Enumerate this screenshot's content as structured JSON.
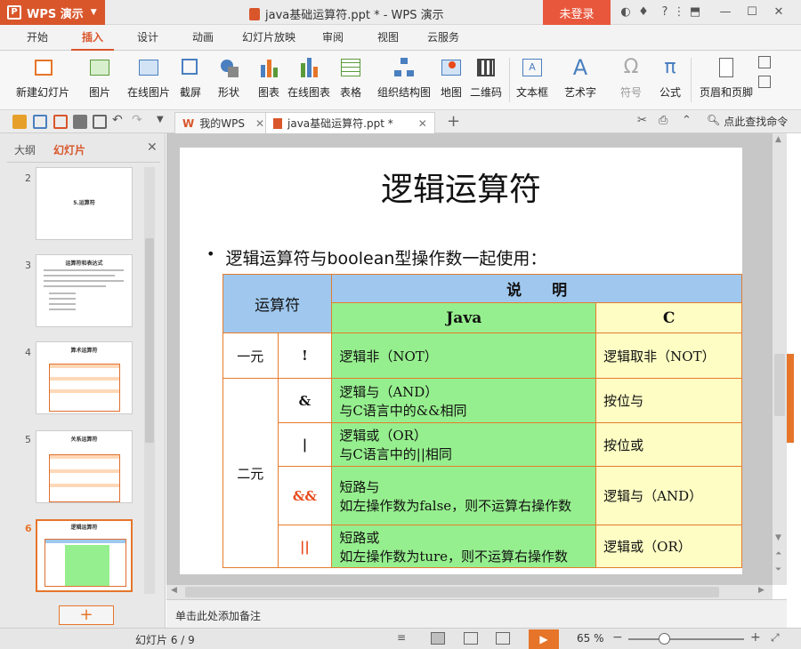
{
  "app": {
    "name": "WPS 演示",
    "window_title": "java基础运算符.ppt * - WPS 演示",
    "login": "未登录"
  },
  "ribbon_tabs": [
    "开始",
    "插入",
    "设计",
    "动画",
    "幻灯片放映",
    "审阅",
    "视图",
    "云服务"
  ],
  "active_tab_index": 1,
  "tools": [
    {
      "label": "新建幻灯片",
      "icon": "new-slide-icon"
    },
    {
      "label": "图片",
      "icon": "picture-icon"
    },
    {
      "label": "在线图片",
      "icon": "online-picture-icon"
    },
    {
      "label": "截屏",
      "icon": "screenshot-icon"
    },
    {
      "label": "形状",
      "icon": "shapes-icon"
    },
    {
      "label": "图表",
      "icon": "chart-icon"
    },
    {
      "label": "在线图表",
      "icon": "online-chart-icon"
    },
    {
      "label": "表格",
      "icon": "table-icon"
    },
    {
      "label": "组织结构图",
      "icon": "org-chart-icon"
    },
    {
      "label": "地图",
      "icon": "map-icon"
    },
    {
      "label": "二维码",
      "icon": "qrcode-icon"
    },
    {
      "label": "文本框",
      "icon": "textbox-icon"
    },
    {
      "label": "艺术字",
      "icon": "wordart-icon"
    },
    {
      "label": "符号",
      "icon": "symbol-icon"
    },
    {
      "label": "公式",
      "icon": "formula-icon"
    },
    {
      "label": "页眉和页脚",
      "icon": "header-footer-icon"
    }
  ],
  "doc_tabs": [
    {
      "label": "我的WPS"
    },
    {
      "label": "java基础运算符.ppt *"
    }
  ],
  "search_hint": "点此查找命令",
  "left_panel": {
    "tabs": [
      "大纲",
      "幻灯片"
    ],
    "slides": [
      {
        "num": "2",
        "title": "5.运算符"
      },
      {
        "num": "3",
        "title": "运算符和表达式"
      },
      {
        "num": "4",
        "title": "算术运算符"
      },
      {
        "num": "5",
        "title": "关系运算符"
      },
      {
        "num": "6",
        "title": "逻辑运算符"
      }
    ],
    "add_label": "+"
  },
  "slide": {
    "title": "逻辑运算符",
    "bullet": "逻辑运算符与boolean型操作数一起使用：",
    "table": {
      "header_op": "运算符",
      "header_desc": "说　　明",
      "header_java": "Java",
      "header_c": "C",
      "group_unary": "一元",
      "group_binary": "二元",
      "rows": [
        {
          "op": "!",
          "java1": "逻辑非（NOT）",
          "java2": "",
          "c": "逻辑取非（NOT）"
        },
        {
          "op": "&",
          "java1": "逻辑与（AND）",
          "java2": "与C语言中的&&相同",
          "c": "按位与"
        },
        {
          "op": "|",
          "java1": "逻辑或（OR）",
          "java2": "与C语言中的||相同",
          "c": "按位或"
        },
        {
          "op": "&&",
          "java1": "短路与",
          "java2": "如左操作数为false，则不运算右操作数",
          "c": "逻辑与（AND）"
        },
        {
          "op": "||",
          "java1": "短路或",
          "java2": "如左操作数为ture，则不运算右操作数",
          "c": "逻辑或（OR）"
        }
      ]
    }
  },
  "notes_placeholder": "单击此处添加备注",
  "status": {
    "slide_count": "幻灯片 6 / 9",
    "zoom": "65 %"
  },
  "colors": {
    "brand": "#d9562b",
    "accent": "#e6752a",
    "table_border": "#e57c2c",
    "header_blue": "#a0c8ee",
    "java_green": "#96ef8e",
    "c_yellow": "#fdfdc4"
  }
}
